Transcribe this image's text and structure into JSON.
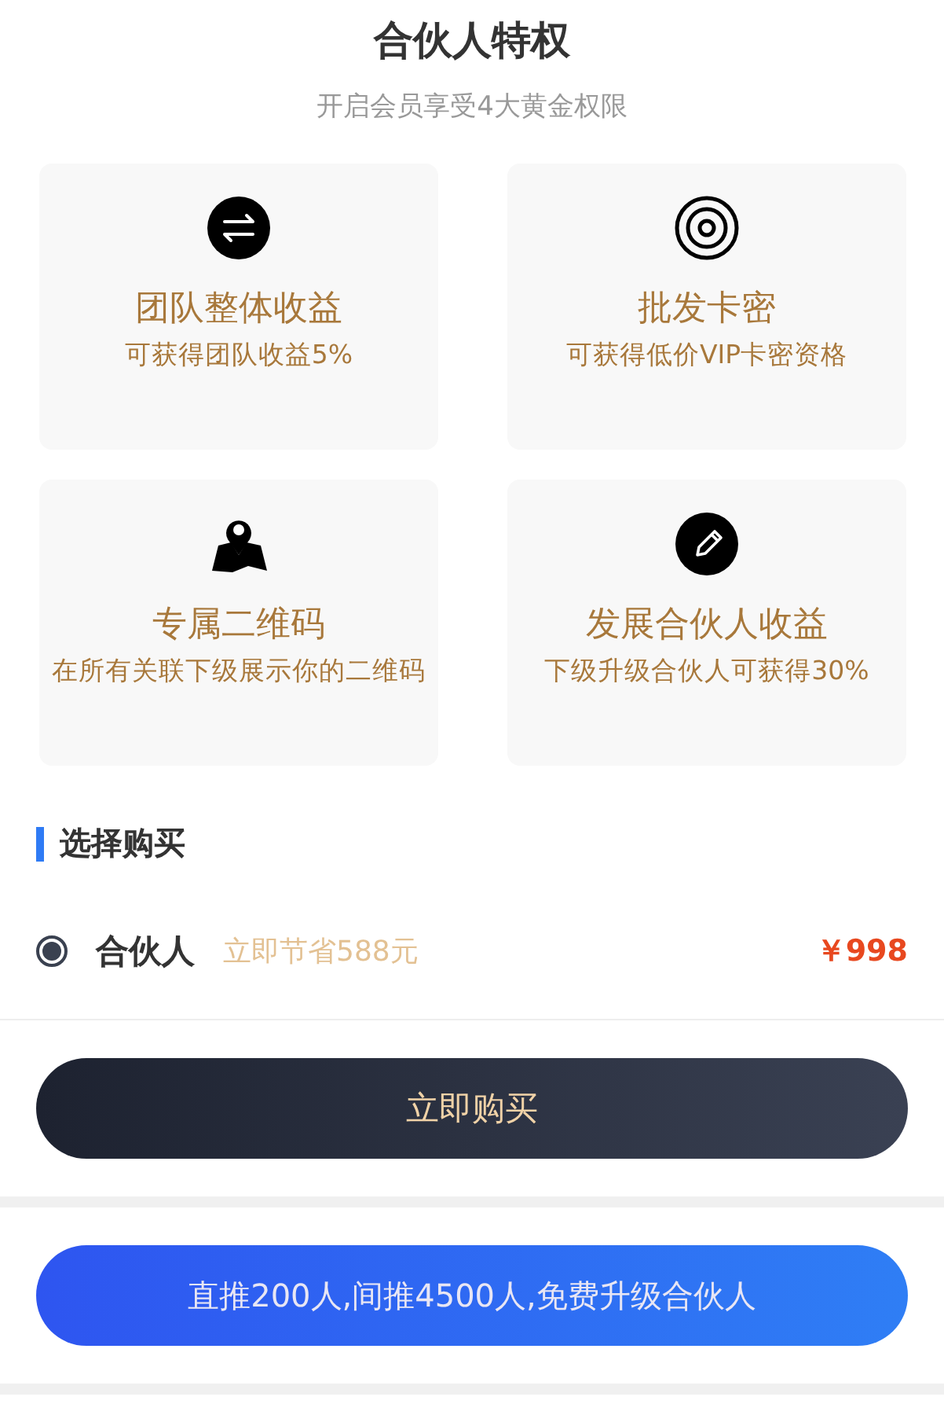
{
  "header": {
    "title": "合伙人特权",
    "subtitle": "开启会员享受4大黄金权限"
  },
  "privileges": [
    {
      "title": "团队整体收益",
      "description": "可获得团队收益5%"
    },
    {
      "title": "批发卡密",
      "description": "可获得低价VIP卡密资格"
    },
    {
      "title": "专属二维码",
      "description": "在所有关联下级展示你的二维码"
    },
    {
      "title": "发展合伙人收益",
      "description": "下级升级合伙人可获得30%"
    }
  ],
  "purchase": {
    "section_title": "选择购买",
    "options": [
      {
        "name": "合伙人",
        "saving": "立即节省588元",
        "price": "￥998",
        "selected": true
      }
    ],
    "buy_button": "立即购买"
  },
  "upgrade_button": "直推200人,间推4500人,免费升级合伙人"
}
